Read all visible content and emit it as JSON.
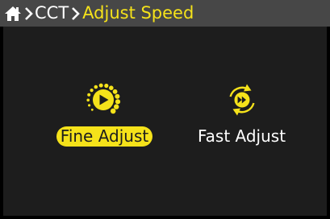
{
  "breadcrumb": {
    "items": [
      "CCT",
      "Adjust Speed"
    ]
  },
  "options": [
    {
      "label": "Fine Adjust",
      "icon": "play-dial-icon",
      "selected": true
    },
    {
      "label": "Fast Adjust",
      "icon": "fast-forward-cycle-icon",
      "selected": false
    }
  ],
  "colors": {
    "accent": "#f5e21a",
    "header_bg": "#474747",
    "panel_bg": "#1d1d1d",
    "text": "#ffffff"
  }
}
